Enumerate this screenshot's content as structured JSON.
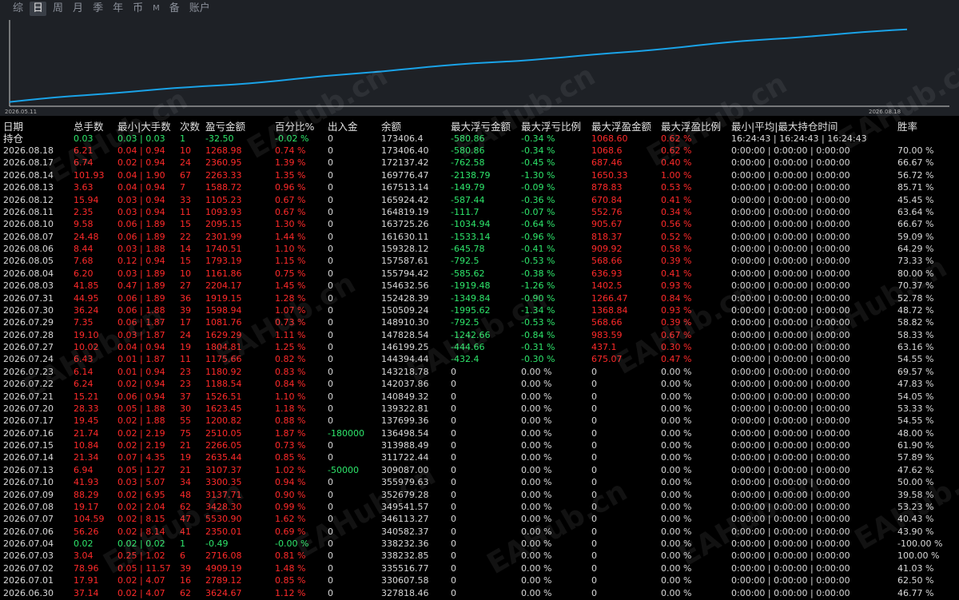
{
  "tabs": [
    {
      "label": "综",
      "active": false
    },
    {
      "label": "日",
      "active": true
    },
    {
      "label": "周",
      "active": false
    },
    {
      "label": "月",
      "active": false
    },
    {
      "label": "季",
      "active": false
    },
    {
      "label": "年",
      "active": false
    },
    {
      "label": "币",
      "active": false
    },
    {
      "label": "M",
      "active": false
    },
    {
      "label": "备",
      "active": false
    },
    {
      "label": "账户",
      "active": false
    }
  ],
  "chart": {
    "start_date": "2026.05.11",
    "end_date": "2026.08.18",
    "line_color": "#1aa3e8",
    "background": "#1e2126",
    "watermark": "EAHub.cn"
  },
  "chart_data": {
    "type": "line",
    "x": [
      "2026.05.11",
      "2026.08.18"
    ],
    "values": [
      0.05,
      0.9
    ],
    "note_visible": false
  },
  "header": {
    "date": "日期",
    "hold": "持仓",
    "total_lots": "总手数",
    "min_max_lots": "最小|大手数",
    "count": "次数",
    "pnl": "盈亏金额",
    "percent": "百分比%",
    "inout": "出入金",
    "balance": "余额",
    "max_float_loss": "最大浮亏金额",
    "max_float_loss_pct": "最大浮亏比例",
    "max_float_profit": "最大浮盈金额",
    "max_float_profit_pct": "最大浮盈比例",
    "hold_time": "最小|平均|最大持仓时间",
    "winrate": "胜率"
  },
  "hold_row": {
    "lots": "0.03",
    "minmax": "0.03 | 0.03",
    "count": "1",
    "pnl": "-32.50",
    "pct": "-0.02 %",
    "inout": "0",
    "balance": "173406.4",
    "fl": "-580.86",
    "flp": "-0.34 %",
    "fp": "1068.60",
    "fpp": "0.62 %",
    "time": "16:24:43 | 16:24:43 | 16:24:43"
  },
  "rows": [
    {
      "d": "2026.08.18",
      "lots": "6.21",
      "mm": "0.04 | 0.94",
      "c": "10",
      "pnl": "1268.98",
      "pct": "0.74 %",
      "io": "0",
      "bal": "173406.40",
      "fl": "-580.86",
      "flp": "-0.34 %",
      "fp": "1068.6",
      "fpp": "0.62 %",
      "t": "0:00:00 | 0:00:00 | 0:00:00",
      "w": "70.00 %"
    },
    {
      "d": "2026.08.17",
      "lots": "6.74",
      "mm": "0.02 | 0.94",
      "c": "24",
      "pnl": "2360.95",
      "pct": "1.39 %",
      "io": "0",
      "bal": "172137.42",
      "fl": "-762.58",
      "flp": "-0.45 %",
      "fp": "687.46",
      "fpp": "0.40 %",
      "t": "0:00:00 | 0:00:00 | 0:00:00",
      "w": "66.67 %"
    },
    {
      "d": "2026.08.14",
      "lots": "101.93",
      "mm": "0.04 | 1.90",
      "c": "67",
      "pnl": "2263.33",
      "pct": "1.35 %",
      "io": "0",
      "bal": "169776.47",
      "fl": "-2138.79",
      "flp": "-1.30 %",
      "fp": "1650.33",
      "fpp": "1.00 %",
      "t": "0:00:00 | 0:00:00 | 0:00:00",
      "w": "56.72 %"
    },
    {
      "d": "2026.08.13",
      "lots": "3.63",
      "mm": "0.04 | 0.94",
      "c": "7",
      "pnl": "1588.72",
      "pct": "0.96 %",
      "io": "0",
      "bal": "167513.14",
      "fl": "-149.79",
      "flp": "-0.09 %",
      "fp": "878.83",
      "fpp": "0.53 %",
      "t": "0:00:00 | 0:00:00 | 0:00:00",
      "w": "85.71 %"
    },
    {
      "d": "2026.08.12",
      "lots": "15.94",
      "mm": "0.03 | 0.94",
      "c": "33",
      "pnl": "1105.23",
      "pct": "0.67 %",
      "io": "0",
      "bal": "165924.42",
      "fl": "-587.44",
      "flp": "-0.36 %",
      "fp": "670.84",
      "fpp": "0.41 %",
      "t": "0:00:00 | 0:00:00 | 0:00:00",
      "w": "45.45 %"
    },
    {
      "d": "2026.08.11",
      "lots": "2.35",
      "mm": "0.03 | 0.94",
      "c": "11",
      "pnl": "1093.93",
      "pct": "0.67 %",
      "io": "0",
      "bal": "164819.19",
      "fl": "-111.7",
      "flp": "-0.07 %",
      "fp": "552.76",
      "fpp": "0.34 %",
      "t": "0:00:00 | 0:00:00 | 0:00:00",
      "w": "63.64 %"
    },
    {
      "d": "2026.08.10",
      "lots": "9.58",
      "mm": "0.06 | 1.89",
      "c": "15",
      "pnl": "2095.15",
      "pct": "1.30 %",
      "io": "0",
      "bal": "163725.26",
      "fl": "-1034.94",
      "flp": "-0.64 %",
      "fp": "905.67",
      "fpp": "0.56 %",
      "t": "0:00:00 | 0:00:00 | 0:00:00",
      "w": "66.67 %"
    },
    {
      "d": "2026.08.07",
      "lots": "24.48",
      "mm": "0.06 | 1.89",
      "c": "22",
      "pnl": "2301.99",
      "pct": "1.44 %",
      "io": "0",
      "bal": "161630.11",
      "fl": "-1533.14",
      "flp": "-0.96 %",
      "fp": "818.37",
      "fpp": "0.52 %",
      "t": "0:00:00 | 0:00:00 | 0:00:00",
      "w": "59.09 %"
    },
    {
      "d": "2026.08.06",
      "lots": "8.44",
      "mm": "0.03 | 1.88",
      "c": "14",
      "pnl": "1740.51",
      "pct": "1.10 %",
      "io": "0",
      "bal": "159328.12",
      "fl": "-645.78",
      "flp": "-0.41 %",
      "fp": "909.92",
      "fpp": "0.58 %",
      "t": "0:00:00 | 0:00:00 | 0:00:00",
      "w": "64.29 %"
    },
    {
      "d": "2026.08.05",
      "lots": "7.68",
      "mm": "0.12 | 0.94",
      "c": "15",
      "pnl": "1793.19",
      "pct": "1.15 %",
      "io": "0",
      "bal": "157587.61",
      "fl": "-792.5",
      "flp": "-0.53 %",
      "fp": "568.66",
      "fpp": "0.39 %",
      "t": "0:00:00 | 0:00:00 | 0:00:00",
      "w": "73.33 %"
    },
    {
      "d": "2026.08.04",
      "lots": "6.20",
      "mm": "0.03 | 1.89",
      "c": "10",
      "pnl": "1161.86",
      "pct": "0.75 %",
      "io": "0",
      "bal": "155794.42",
      "fl": "-585.62",
      "flp": "-0.38 %",
      "fp": "636.93",
      "fpp": "0.41 %",
      "t": "0:00:00 | 0:00:00 | 0:00:00",
      "w": "80.00 %"
    },
    {
      "d": "2026.08.03",
      "lots": "41.85",
      "mm": "0.47 | 1.89",
      "c": "27",
      "pnl": "2204.17",
      "pct": "1.45 %",
      "io": "0",
      "bal": "154632.56",
      "fl": "-1919.48",
      "flp": "-1.26 %",
      "fp": "1402.5",
      "fpp": "0.93 %",
      "t": "0:00:00 | 0:00:00 | 0:00:00",
      "w": "70.37 %"
    },
    {
      "d": "2026.07.31",
      "lots": "44.95",
      "mm": "0.06 | 1.89",
      "c": "36",
      "pnl": "1919.15",
      "pct": "1.28 %",
      "io": "0",
      "bal": "152428.39",
      "fl": "-1349.84",
      "flp": "-0.90 %",
      "fp": "1266.47",
      "fpp": "0.84 %",
      "t": "0:00:00 | 0:00:00 | 0:00:00",
      "w": "52.78 %"
    },
    {
      "d": "2026.07.30",
      "lots": "36.24",
      "mm": "0.06 | 1.88",
      "c": "39",
      "pnl": "1598.94",
      "pct": "1.07 %",
      "io": "0",
      "bal": "150509.24",
      "fl": "-1995.62",
      "flp": "-1.34 %",
      "fp": "1368.84",
      "fpp": "0.93 %",
      "t": "0:00:00 | 0:00:00 | 0:00:00",
      "w": "48.72 %"
    },
    {
      "d": "2026.07.29",
      "lots": "7.35",
      "mm": "0.06 | 1.87",
      "c": "17",
      "pnl": "1081.76",
      "pct": "0.73 %",
      "io": "0",
      "bal": "148910.30",
      "fl": "-792.5",
      "flp": "-0.53 %",
      "fp": "568.66",
      "fpp": "0.39 %",
      "t": "0:00:00 | 0:00:00 | 0:00:00",
      "w": "58.82 %"
    },
    {
      "d": "2026.07.28",
      "lots": "19.10",
      "mm": "0.03 | 1.87",
      "c": "24",
      "pnl": "1629.29",
      "pct": "1.11 %",
      "io": "0",
      "bal": "147828.54",
      "fl": "-1242.66",
      "flp": "-0.84 %",
      "fp": "983.59",
      "fpp": "0.67 %",
      "t": "0:00:00 | 0:00:00 | 0:00:00",
      "w": "58.33 %"
    },
    {
      "d": "2026.07.27",
      "lots": "10.02",
      "mm": "0.04 | 0.94",
      "c": "19",
      "pnl": "1804.81",
      "pct": "1.25 %",
      "io": "0",
      "bal": "146199.25",
      "fl": "-444.66",
      "flp": "-0.31 %",
      "fp": "437.1",
      "fpp": "0.30 %",
      "t": "0:00:00 | 0:00:00 | 0:00:00",
      "w": "63.16 %"
    },
    {
      "d": "2026.07.24",
      "lots": "6.43",
      "mm": "0.01 | 1.87",
      "c": "11",
      "pnl": "1175.66",
      "pct": "0.82 %",
      "io": "0",
      "bal": "144394.44",
      "fl": "-432.4",
      "flp": "-0.30 %",
      "fp": "675.07",
      "fpp": "0.47 %",
      "t": "0:00:00 | 0:00:00 | 0:00:00",
      "w": "54.55 %"
    },
    {
      "d": "2026.07.23",
      "lots": "6.14",
      "mm": "0.01 | 0.94",
      "c": "23",
      "pnl": "1180.92",
      "pct": "0.83 %",
      "io": "0",
      "bal": "143218.78",
      "fl": "0",
      "flp": "0.00 %",
      "fp": "0",
      "fpp": "0.00 %",
      "t": "0:00:00 | 0:00:00 | 0:00:00",
      "w": "69.57 %"
    },
    {
      "d": "2026.07.22",
      "lots": "6.24",
      "mm": "0.02 | 0.94",
      "c": "23",
      "pnl": "1188.54",
      "pct": "0.84 %",
      "io": "0",
      "bal": "142037.86",
      "fl": "0",
      "flp": "0.00 %",
      "fp": "0",
      "fpp": "0.00 %",
      "t": "0:00:00 | 0:00:00 | 0:00:00",
      "w": "47.83 %"
    },
    {
      "d": "2026.07.21",
      "lots": "15.21",
      "mm": "0.06 | 0.94",
      "c": "37",
      "pnl": "1526.51",
      "pct": "1.10 %",
      "io": "0",
      "bal": "140849.32",
      "fl": "0",
      "flp": "0.00 %",
      "fp": "0",
      "fpp": "0.00 %",
      "t": "0:00:00 | 0:00:00 | 0:00:00",
      "w": "54.05 %"
    },
    {
      "d": "2026.07.20",
      "lots": "28.33",
      "mm": "0.05 | 1.88",
      "c": "30",
      "pnl": "1623.45",
      "pct": "1.18 %",
      "io": "0",
      "bal": "139322.81",
      "fl": "0",
      "flp": "0.00 %",
      "fp": "0",
      "fpp": "0.00 %",
      "t": "0:00:00 | 0:00:00 | 0:00:00",
      "w": "53.33 %"
    },
    {
      "d": "2026.07.17",
      "lots": "19.45",
      "mm": "0.02 | 1.88",
      "c": "55",
      "pnl": "1200.82",
      "pct": "0.88 %",
      "io": "0",
      "bal": "137699.36",
      "fl": "0",
      "flp": "0.00 %",
      "fp": "0",
      "fpp": "0.00 %",
      "t": "0:00:00 | 0:00:00 | 0:00:00",
      "w": "54.55 %"
    },
    {
      "d": "2026.07.16",
      "lots": "21.74",
      "mm": "0.02 | 2.19",
      "c": "75",
      "pnl": "2510.05",
      "pct": "1.87 %",
      "io": "-180000",
      "bal": "136498.54",
      "fl": "0",
      "flp": "0.00 %",
      "fp": "0",
      "fpp": "0.00 %",
      "t": "0:00:00 | 0:00:00 | 0:00:00",
      "w": "48.00 %"
    },
    {
      "d": "2026.07.15",
      "lots": "10.84",
      "mm": "0.02 | 2.19",
      "c": "21",
      "pnl": "2266.05",
      "pct": "0.73 %",
      "io": "0",
      "bal": "313988.49",
      "fl": "0",
      "flp": "0.00 %",
      "fp": "0",
      "fpp": "0.00 %",
      "t": "0:00:00 | 0:00:00 | 0:00:00",
      "w": "61.90 %"
    },
    {
      "d": "2026.07.14",
      "lots": "21.34",
      "mm": "0.07 | 4.35",
      "c": "19",
      "pnl": "2635.44",
      "pct": "0.85 %",
      "io": "0",
      "bal": "311722.44",
      "fl": "0",
      "flp": "0.00 %",
      "fp": "0",
      "fpp": "0.00 %",
      "t": "0:00:00 | 0:00:00 | 0:00:00",
      "w": "57.89 %"
    },
    {
      "d": "2026.07.13",
      "lots": "6.94",
      "mm": "0.05 | 1.27",
      "c": "21",
      "pnl": "3107.37",
      "pct": "1.02 %",
      "io": "-50000",
      "bal": "309087.00",
      "fl": "0",
      "flp": "0.00 %",
      "fp": "0",
      "fpp": "0.00 %",
      "t": "0:00:00 | 0:00:00 | 0:00:00",
      "w": "47.62 %"
    },
    {
      "d": "2026.07.10",
      "lots": "41.93",
      "mm": "0.03 | 5.07",
      "c": "34",
      "pnl": "3300.35",
      "pct": "0.94 %",
      "io": "0",
      "bal": "355979.63",
      "fl": "0",
      "flp": "0.00 %",
      "fp": "0",
      "fpp": "0.00 %",
      "t": "0:00:00 | 0:00:00 | 0:00:00",
      "w": "50.00 %"
    },
    {
      "d": "2026.07.09",
      "lots": "88.29",
      "mm": "0.02 | 6.95",
      "c": "48",
      "pnl": "3137.71",
      "pct": "0.90 %",
      "io": "0",
      "bal": "352679.28",
      "fl": "0",
      "flp": "0.00 %",
      "fp": "0",
      "fpp": "0.00 %",
      "t": "0:00:00 | 0:00:00 | 0:00:00",
      "w": "39.58 %"
    },
    {
      "d": "2026.07.08",
      "lots": "19.17",
      "mm": "0.02 | 2.04",
      "c": "62",
      "pnl": "3428.30",
      "pct": "0.99 %",
      "io": "0",
      "bal": "349541.57",
      "fl": "0",
      "flp": "0.00 %",
      "fp": "0",
      "fpp": "0.00 %",
      "t": "0:00:00 | 0:00:00 | 0:00:00",
      "w": "53.23 %"
    },
    {
      "d": "2026.07.07",
      "lots": "104.59",
      "mm": "0.02 | 8.15",
      "c": "47",
      "pnl": "5530.90",
      "pct": "1.62 %",
      "io": "0",
      "bal": "346113.27",
      "fl": "0",
      "flp": "0.00 %",
      "fp": "0",
      "fpp": "0.00 %",
      "t": "0:00:00 | 0:00:00 | 0:00:00",
      "w": "40.43 %"
    },
    {
      "d": "2026.07.06",
      "lots": "56.26",
      "mm": "0.02 | 8.14",
      "c": "41",
      "pnl": "2350.01",
      "pct": "0.69 %",
      "io": "0",
      "bal": "340582.37",
      "fl": "0",
      "flp": "0.00 %",
      "fp": "0",
      "fpp": "0.00 %",
      "t": "0:00:00 | 0:00:00 | 0:00:00",
      "w": "43.90 %"
    },
    {
      "d": "2026.07.04",
      "lots": "0.02",
      "mm": "0.02 | 0.02",
      "c": "1",
      "pnl": "-0.49",
      "pct": "-0.00 %",
      "io": "0",
      "bal": "338232.36",
      "fl": "0",
      "flp": "0.00 %",
      "fp": "0",
      "fpp": "0.00 %",
      "t": "0:00:00 | 0:00:00 | 0:00:00",
      "w": "-100.00 %"
    },
    {
      "d": "2026.07.03",
      "lots": "3.04",
      "mm": "0.25 | 1.02",
      "c": "6",
      "pnl": "2716.08",
      "pct": "0.81 %",
      "io": "0",
      "bal": "338232.85",
      "fl": "0",
      "flp": "0.00 %",
      "fp": "0",
      "fpp": "0.00 %",
      "t": "0:00:00 | 0:00:00 | 0:00:00",
      "w": "100.00 %"
    },
    {
      "d": "2026.07.02",
      "lots": "78.96",
      "mm": "0.05 | 11.57",
      "c": "39",
      "pnl": "4909.19",
      "pct": "1.48 %",
      "io": "0",
      "bal": "335516.77",
      "fl": "0",
      "flp": "0.00 %",
      "fp": "0",
      "fpp": "0.00 %",
      "t": "0:00:00 | 0:00:00 | 0:00:00",
      "w": "41.03 %"
    },
    {
      "d": "2026.07.01",
      "lots": "17.91",
      "mm": "0.02 | 4.07",
      "c": "16",
      "pnl": "2789.12",
      "pct": "0.85 %",
      "io": "0",
      "bal": "330607.58",
      "fl": "0",
      "flp": "0.00 %",
      "fp": "0",
      "fpp": "0.00 %",
      "t": "0:00:00 | 0:00:00 | 0:00:00",
      "w": "62.50 %"
    },
    {
      "d": "2026.06.30",
      "lots": "37.14",
      "mm": "0.02 | 4.07",
      "c": "62",
      "pnl": "3624.67",
      "pct": "1.12 %",
      "io": "0",
      "bal": "327818.46",
      "fl": "0",
      "flp": "0.00 %",
      "fp": "0",
      "fpp": "0.00 %",
      "t": "0:00:00 | 0:00:00 | 0:00:00",
      "w": "46.77 %"
    }
  ]
}
